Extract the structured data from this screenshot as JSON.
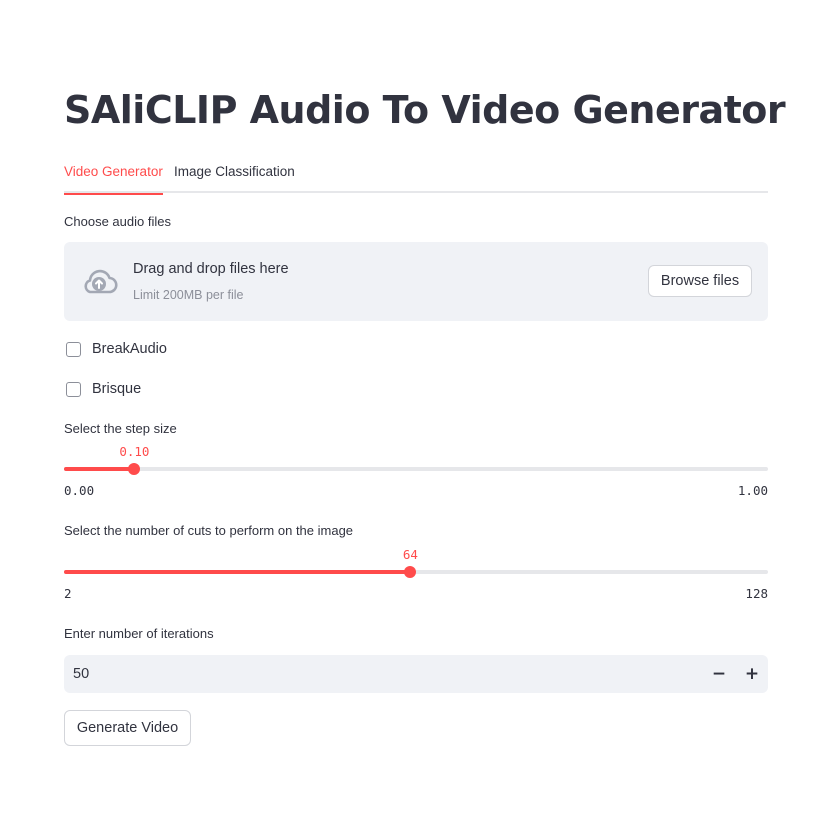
{
  "page": {
    "title": "SAliCLIP Audio To Video Generator"
  },
  "tabs": [
    {
      "label": "Video Generator",
      "active": true
    },
    {
      "label": "Image Classification",
      "active": false
    }
  ],
  "uploader": {
    "label": "Choose audio files",
    "drop_title": "Drag and drop files here",
    "drop_hint": "Limit 200MB per file",
    "browse_label": "Browse files",
    "icon": "cloud-upload-icon"
  },
  "checkboxes": [
    {
      "label": "BreakAudio",
      "checked": false
    },
    {
      "label": "Brisque",
      "checked": false
    }
  ],
  "step_slider": {
    "label": "Select the step size",
    "value": 0.1,
    "value_text": "0.10",
    "min": 0,
    "max": 1,
    "min_text": "0.00",
    "max_text": "1.00"
  },
  "cuts_slider": {
    "label": "Select the number of cuts to perform on the image",
    "value": 64,
    "value_text": "64",
    "min": 2,
    "max": 128,
    "min_text": "2",
    "max_text": "128"
  },
  "iterations": {
    "label": "Enter number of iterations",
    "value": "50",
    "minus_label": "−",
    "plus_label": "+"
  },
  "generate_button": {
    "label": "Generate Video"
  },
  "colors": {
    "accent": "#ff4b4b",
    "text": "#31333f",
    "muted": "#8c8f99",
    "panel": "#f0f2f6",
    "track": "#e6e7ea"
  }
}
